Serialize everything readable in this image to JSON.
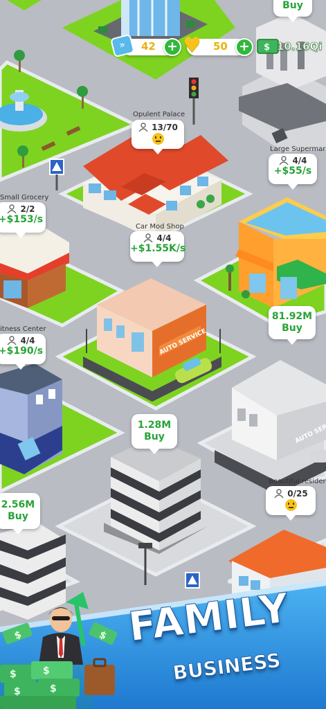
{
  "hud": {
    "tickets": "42",
    "hearts": "50",
    "cash": "10.16Qi",
    "ticket_plus": "+",
    "heart_plus": "+"
  },
  "buildings": {
    "top_right": {
      "buy_label": "Buy"
    },
    "opulent_palace": {
      "name": "Opulent Palace",
      "occupancy": "13/70"
    },
    "large_supermarket": {
      "name": "Large Supermarke",
      "occupancy": "4/4",
      "rate": "+$55/s"
    },
    "small_grocery": {
      "name": "Small Grocery",
      "occupancy": "2/2",
      "rate": "+$153/s"
    },
    "car_mod_shop": {
      "name": "Car Mod Shop",
      "occupancy": "4/4",
      "rate": "+$1.55K/s",
      "sign": "AUTO SERVICE"
    },
    "fitness_center": {
      "name": "itness Center",
      "occupancy": "4/4",
      "rate": "+$190/s"
    },
    "auto_service_2": {
      "price": "81.92M",
      "buy_label": "Buy",
      "sign": "AUTO SERV"
    },
    "office_tower": {
      "price": "1.28M",
      "buy_label": "Buy"
    },
    "left_tower": {
      "price": "2.56M",
      "buy_label": "Buy"
    },
    "beautiful_residence": {
      "name": "Beautiful residenc",
      "occupancy": "0/25"
    }
  },
  "banner": {
    "title": "FAMILY",
    "subtitle": "BUSINESS"
  },
  "colors": {
    "road": "#b9bcc3",
    "grass": "#7ed321",
    "green_text": "#27a337",
    "banner_blue": "#2f8fe0"
  }
}
